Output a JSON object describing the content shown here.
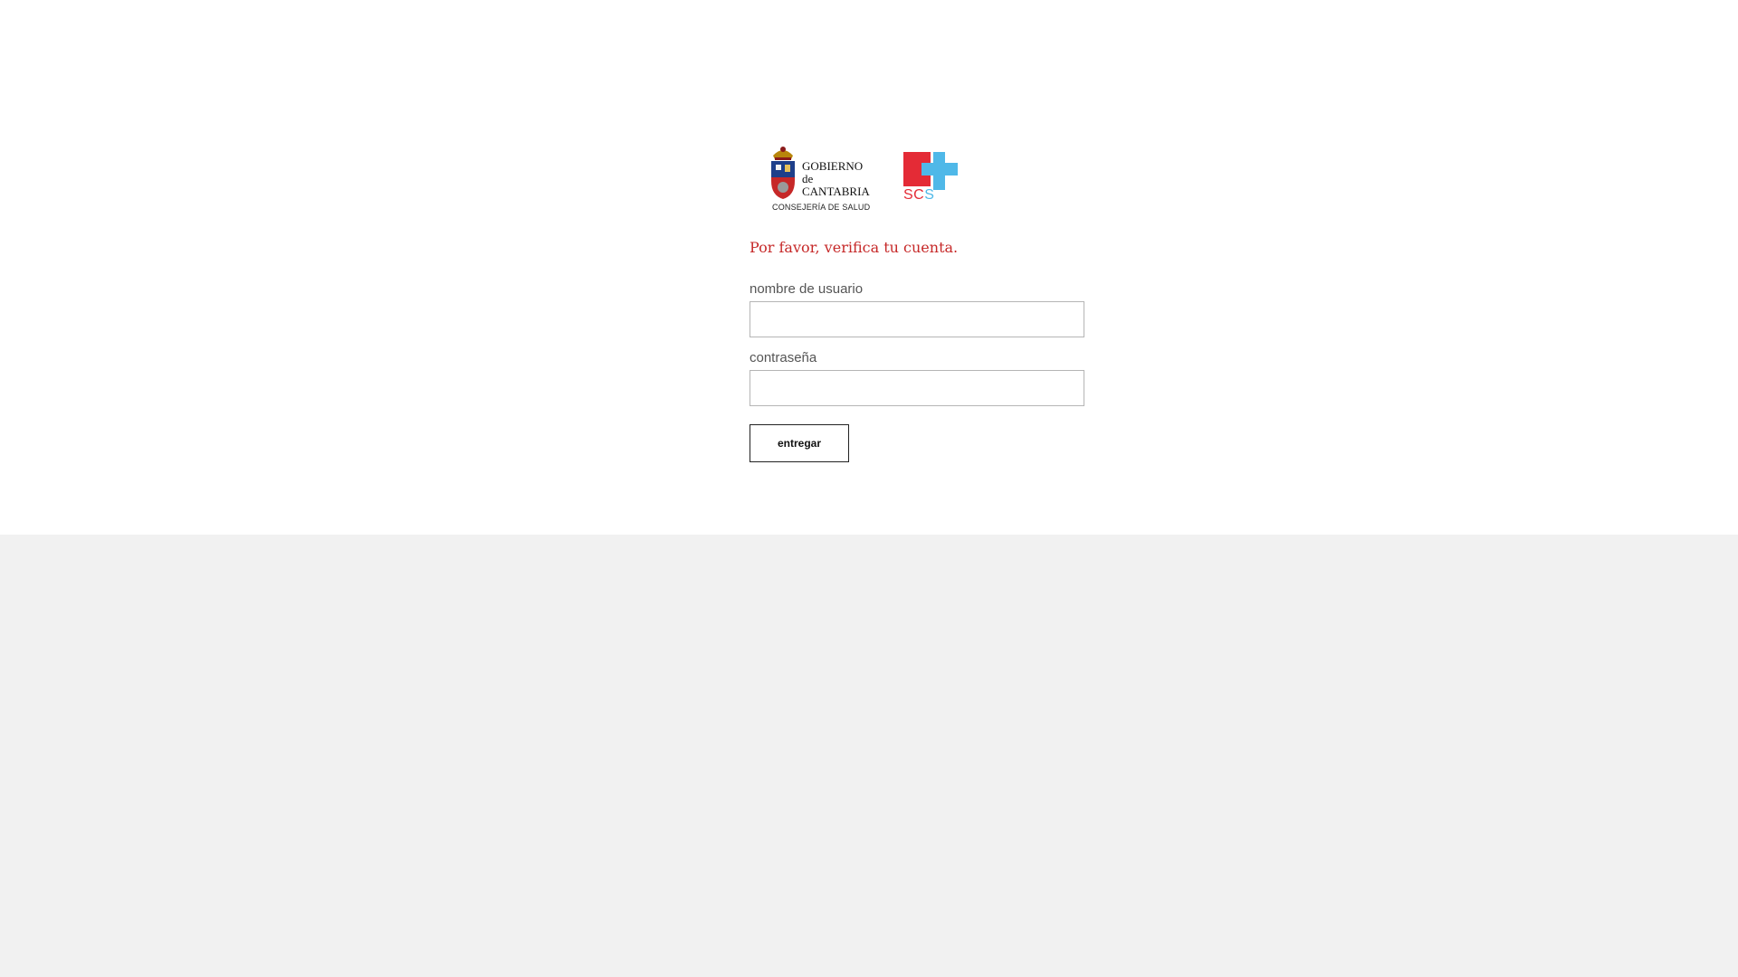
{
  "logos": {
    "gobierno_line1": "GOBIERNO",
    "gobierno_line2": "de",
    "gobierno_line3": "CANTABRIA",
    "gobierno_sub": "CONSEJERÍA DE SALUD",
    "scs_s1": "S",
    "scs_c": "C",
    "scs_s2": "S",
    "shield_icon": "coat-of-arms-icon",
    "scs_icon": "medical-cross-icon"
  },
  "form": {
    "heading": "Por favor, verifica tu cuenta.",
    "username_label": "nombre de usuario",
    "username_value": "",
    "password_label": "contraseña",
    "password_value": "",
    "submit_label": "entregar"
  },
  "colors": {
    "heading": "#c62828",
    "scs_red": "#e42b36",
    "scs_blue": "#4fb8e8",
    "footer_bg": "#f1f1f1"
  }
}
